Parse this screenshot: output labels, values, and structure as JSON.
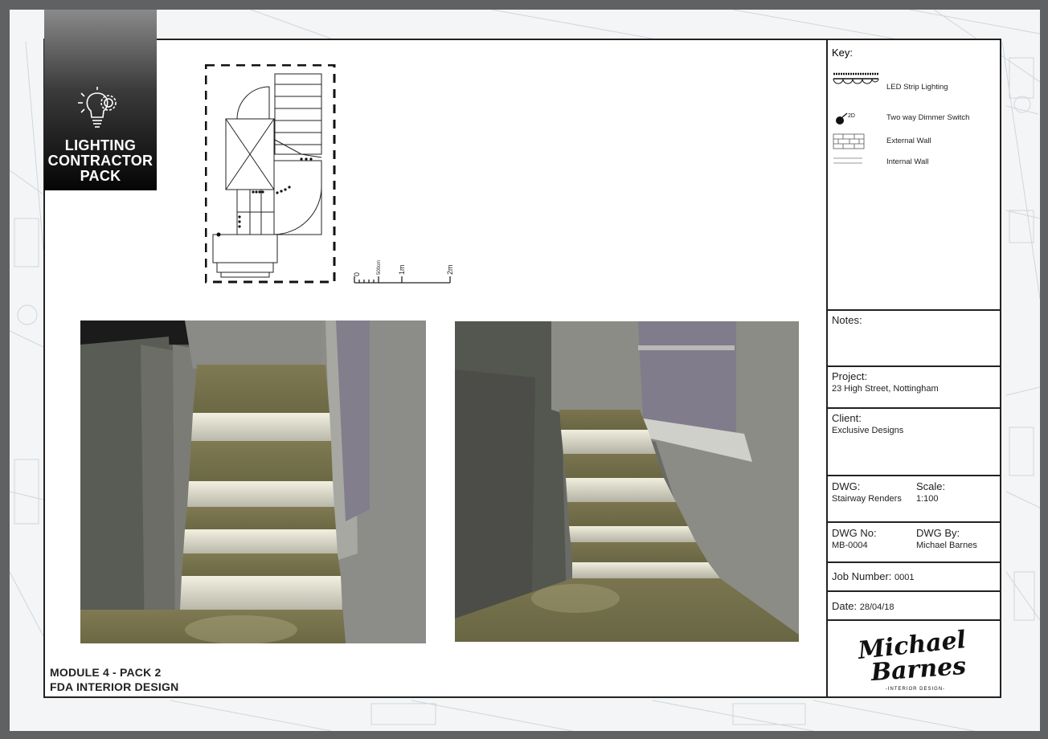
{
  "badge": {
    "title_line1": "LIGHTING",
    "title_line2": "CONTRACTOR",
    "title_line3": "PACK",
    "icon": "lightbulb-gear-icon"
  },
  "scale_bar": {
    "label_0": "0",
    "label_500": "500cm",
    "label_1m": "1m",
    "label_2m": "2m"
  },
  "key": {
    "title": "Key:",
    "items": [
      {
        "label": "LED Strip Lighting",
        "icon": "led-strip-icon"
      },
      {
        "label": "Two way Dimmer Switch",
        "icon": "dimmer-switch-icon",
        "tag": "2D"
      },
      {
        "label": "External Wall",
        "icon": "external-wall-icon"
      },
      {
        "label": "Internal Wall",
        "icon": "internal-wall-icon"
      }
    ]
  },
  "notes": {
    "label": "Notes:"
  },
  "project": {
    "label": "Project:",
    "value": "23 High Street, Nottingham"
  },
  "client": {
    "label": "Client:",
    "value": "Exclusive Designs"
  },
  "dwg": {
    "label": "DWG:",
    "value": "Stairway Renders"
  },
  "scale": {
    "label": "Scale:",
    "value": "1:100"
  },
  "dwg_no": {
    "label": "DWG No:",
    "value": "MB-0004"
  },
  "dwg_by": {
    "label": "DWG By:",
    "value": "Michael Barnes"
  },
  "job_number": {
    "label": "Job Number:",
    "value": "0001"
  },
  "date": {
    "label": "Date:",
    "value": "28/04/18"
  },
  "logo": {
    "line1": "Michael",
    "line2": "Barnes",
    "tagline": "-INTERIOR DESIGN-"
  },
  "module": {
    "line1": "MODULE 4 - PACK 2",
    "line2": "FDA INTERIOR DESIGN"
  }
}
